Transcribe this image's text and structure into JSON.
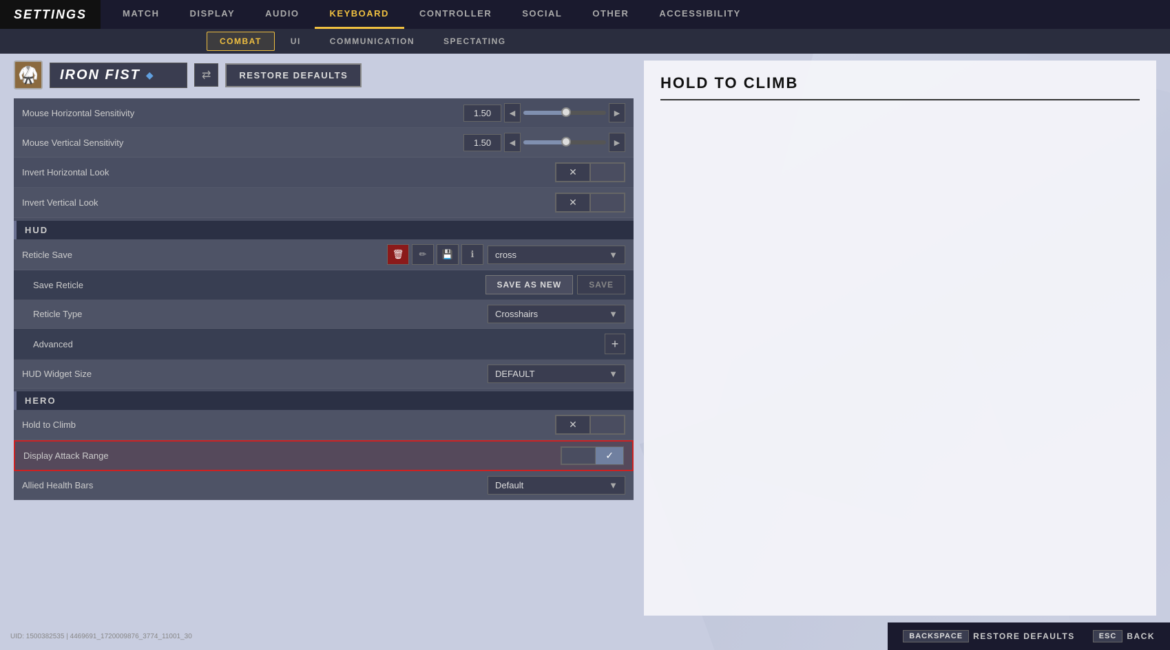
{
  "app": {
    "title": "SETTINGS"
  },
  "nav": {
    "items": [
      {
        "label": "MATCH",
        "active": false
      },
      {
        "label": "DISPLAY",
        "active": false
      },
      {
        "label": "AUDIO",
        "active": false
      },
      {
        "label": "KEYBOARD",
        "active": true
      },
      {
        "label": "CONTROLLER",
        "active": false
      },
      {
        "label": "SOCIAL",
        "active": false
      },
      {
        "label": "OTHER",
        "active": false
      },
      {
        "label": "ACCESSIBILITY",
        "active": false
      }
    ]
  },
  "sub_nav": {
    "items": [
      {
        "label": "COMBAT",
        "active": true
      },
      {
        "label": "UI",
        "active": false
      },
      {
        "label": "COMMUNICATION",
        "active": false
      },
      {
        "label": "SPECTATING",
        "active": false
      }
    ]
  },
  "character": {
    "name": "IRON FIST",
    "avatar_emoji": "🥋",
    "restore_label": "RESTORE DEFAULTS"
  },
  "settings": {
    "sections": {
      "mouse": {
        "rows": [
          {
            "label": "Mouse Horizontal Sensitivity",
            "value": "1.50",
            "type": "slider"
          },
          {
            "label": "Mouse Vertical Sensitivity",
            "value": "1.50",
            "type": "slider"
          },
          {
            "label": "Invert Horizontal Look",
            "type": "toggle_x"
          },
          {
            "label": "Invert Vertical Look",
            "type": "toggle_x"
          }
        ]
      },
      "hud": {
        "header": "HUD",
        "rows": [
          {
            "label": "Reticle Save",
            "type": "reticle_save",
            "dropdown_value": "cross"
          },
          {
            "label": "Save Reticle",
            "type": "save_reticle"
          },
          {
            "label": "Reticle Type",
            "type": "dropdown",
            "value": "Crosshairs"
          },
          {
            "label": "Advanced",
            "type": "advanced"
          },
          {
            "label": "HUD Widget Size",
            "type": "dropdown",
            "value": "DEFAULT"
          }
        ]
      },
      "hero": {
        "header": "HERO",
        "rows": [
          {
            "label": "Hold to Climb",
            "type": "toggle_x"
          },
          {
            "label": "Display Attack Range",
            "type": "toggle_check",
            "highlighted": true
          },
          {
            "label": "Allied Health Bars",
            "type": "dropdown",
            "value": "Default"
          }
        ]
      }
    }
  },
  "right_panel": {
    "title": "HOLD TO CLIMB",
    "content": ""
  },
  "bottom_bar": {
    "buttons": [
      {
        "key": "BACKSPACE",
        "label": "RESTORE DEFAULTS"
      },
      {
        "key": "ESC",
        "label": "BACK"
      }
    ]
  },
  "status": {
    "text": "UID: 1500382535 | 4469691_1720009876_3774_11001_30"
  },
  "labels": {
    "save_as_new": "SAVE AS NEW",
    "save": "SAVE",
    "cross": "cross",
    "crosshairs": "Crosshairs",
    "default": "DEFAULT",
    "default_lower": "Default"
  }
}
